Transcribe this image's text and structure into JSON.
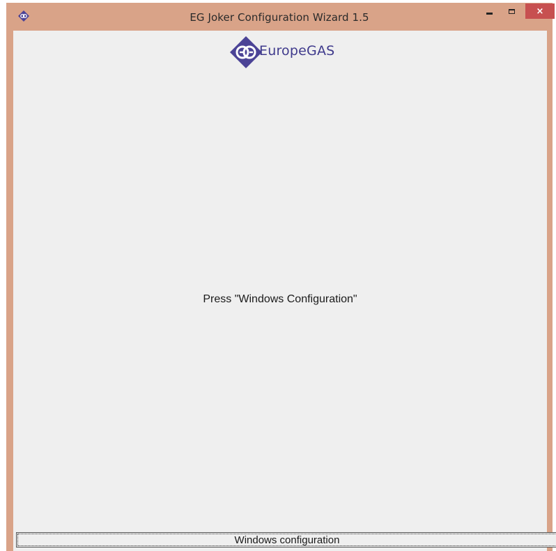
{
  "window": {
    "title": "EG Joker Configuration Wizard  1.5",
    "close_glyph": "×",
    "icons": {
      "app": "europegas-app-icon",
      "minimize": "minimize-icon",
      "maximize": "maximize-icon",
      "close": "close-icon"
    },
    "colors": {
      "frame": "#d9a388",
      "close_button": "#c75050",
      "client_background": "#efefef",
      "brand": "#3f3a8c"
    }
  },
  "logo": {
    "brand_name": "EuropeGAS",
    "icon": "europegas-logo-icon"
  },
  "main": {
    "message": "Press \"Windows Configuration\""
  },
  "footer": {
    "button_label": "Windows configuration"
  }
}
